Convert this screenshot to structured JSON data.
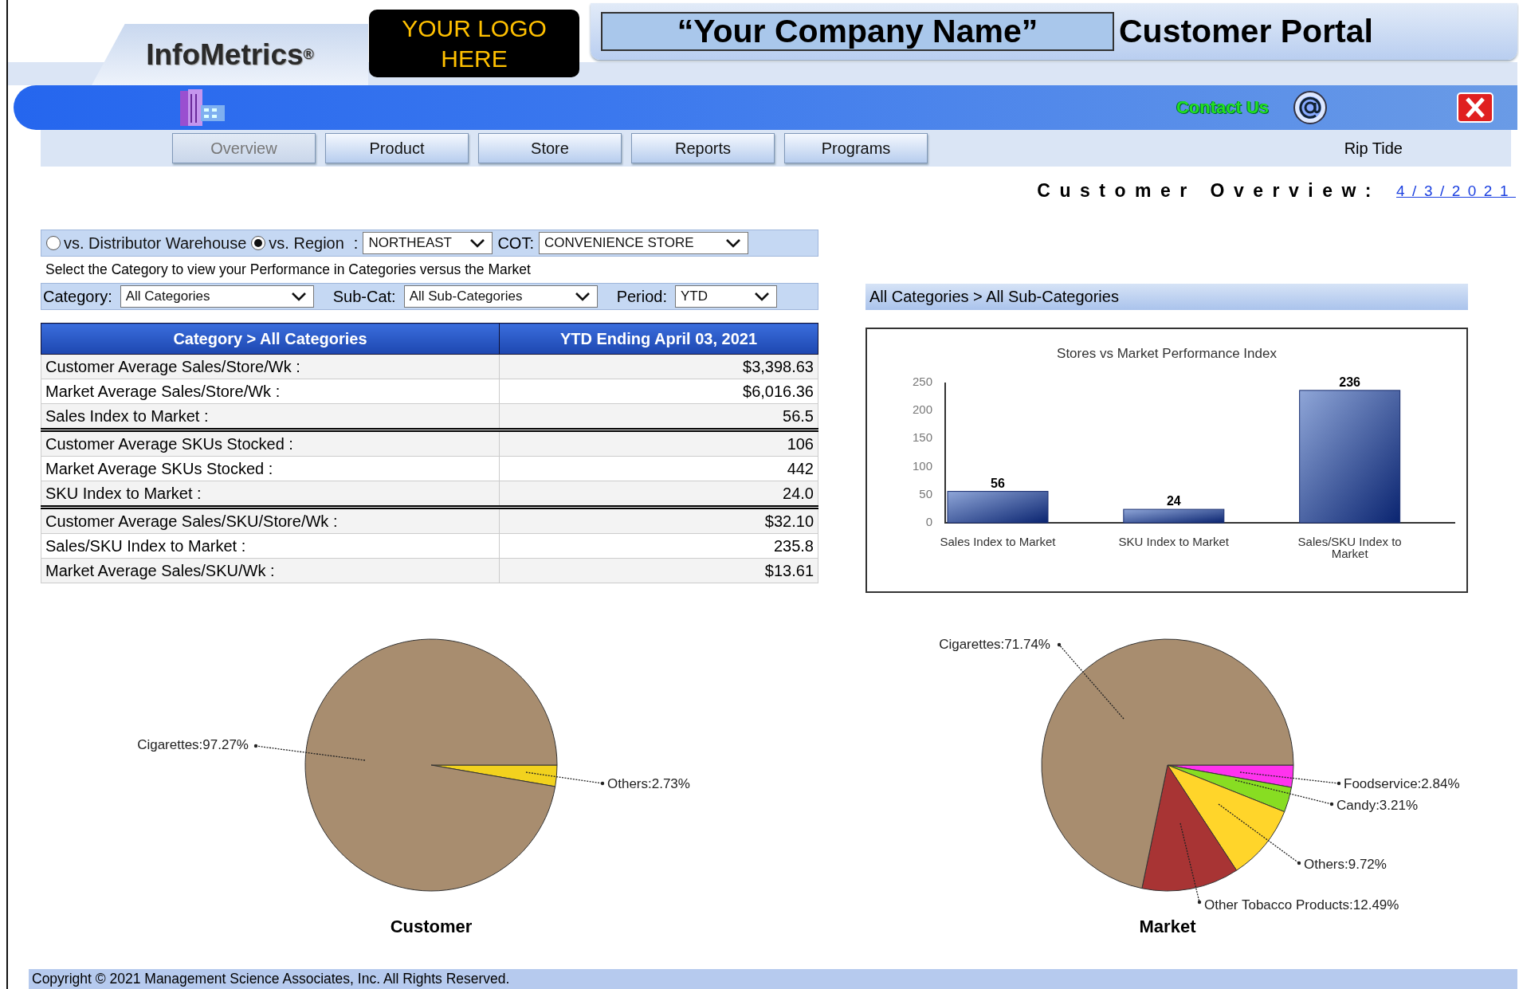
{
  "header": {
    "brand": "InfoMetrics$^{®}$",
    "logo_placeholder": "YOUR LOGO HERE",
    "company_name": "“Your Company Name”",
    "portal_title": "Customer Portal"
  },
  "toolbar": {
    "contact_link": "Contact Us"
  },
  "tabs": [
    {
      "label": "Overview",
      "selected": true
    },
    {
      "label": "Product",
      "selected": false
    },
    {
      "label": "Store",
      "selected": false
    },
    {
      "label": "Reports",
      "selected": false
    },
    {
      "label": "Programs",
      "selected": false
    }
  ],
  "user_name": "Rip Tide",
  "page_title": "Customer Overview:",
  "date_link": "4/3/2021",
  "filters": {
    "comparison": [
      {
        "label": "vs. Distributor Warehouse",
        "selected": false
      },
      {
        "label": "vs. Region",
        "selected": true
      }
    ],
    "region_separator": ":",
    "region": "NORTHEAST",
    "cot_label": "COT:",
    "cot": "CONVENIENCE STORE",
    "hint": "Select the Category to view your Performance in Categories versus the Market",
    "category_label": "Category:",
    "category": "All Categories",
    "subcat_label": "Sub-Cat:",
    "subcat": "All Sub-Categories",
    "period_label": "Period:",
    "period": "YTD"
  },
  "table": {
    "columns": [
      "Category > All Categories",
      "YTD Ending April 03, 2021"
    ],
    "groups": [
      [
        {
          "label": "Customer Average Sales/Store/Wk :",
          "value": "$3,398.63"
        },
        {
          "label": "Market Average Sales/Store/Wk :",
          "value": "$6,016.36"
        },
        {
          "label": "Sales Index to Market :",
          "value": "56.5"
        }
      ],
      [
        {
          "label": "Customer Average SKUs Stocked :",
          "value": "106"
        },
        {
          "label": "Market Average SKUs Stocked :",
          "value": "442"
        },
        {
          "label": "SKU Index to Market :",
          "value": "24.0"
        }
      ],
      [
        {
          "label": "Customer Average Sales/SKU/Store/Wk :",
          "value": "$32.10"
        },
        {
          "label": "Sales/SKU Index to Market :",
          "value": "235.8"
        },
        {
          "label": "Market Average Sales/SKU/Wk :",
          "value": "$13.61"
        }
      ]
    ]
  },
  "breadcrumb": "All Categories > All Sub-Categories",
  "bar_chart": {
    "chart_data": {
      "type": "bar",
      "title": "Stores vs Market Performance Index",
      "categories": [
        "Sales Index to Market",
        "SKU Index to Market",
        "Sales/SKU Index to Market"
      ],
      "values": [
        56,
        24,
        236
      ],
      "ylim": [
        0,
        250
      ],
      "yticks": [
        0,
        50,
        100,
        150,
        200,
        250
      ],
      "value_labels": [
        "56",
        "24",
        "236"
      ]
    }
  },
  "customer_pie": {
    "slices": [
      {
        "label": "Others:2.73%",
        "color": "#f2d21e"
      },
      {
        "label": "Cigarettes:97.27%",
        "color": "#a88d6f"
      }
    ],
    "chart_data": {
      "type": "pie",
      "title": "Customer",
      "values": [
        2.73,
        97.27
      ]
    }
  },
  "market_pie": {
    "slices": [
      {
        "label": "Foodservice:2.84%",
        "color": "#ff33ee"
      },
      {
        "label": "Candy:3.21%",
        "color": "#88dd22"
      },
      {
        "label": "Others:9.72%",
        "color": "#ffd52a"
      },
      {
        "label": "Other Tobacco Products:12.49%",
        "color": "#a83434"
      },
      {
        "label": "Cigarettes:71.74%",
        "color": "#a88d6f"
      }
    ],
    "chart_data": {
      "type": "pie",
      "title": "Market",
      "values": [
        2.84,
        3.21,
        9.72,
        12.49,
        71.74
      ]
    }
  },
  "footer": "Copyright © 2021 Management Science Associates, Inc. All Rights Reserved."
}
